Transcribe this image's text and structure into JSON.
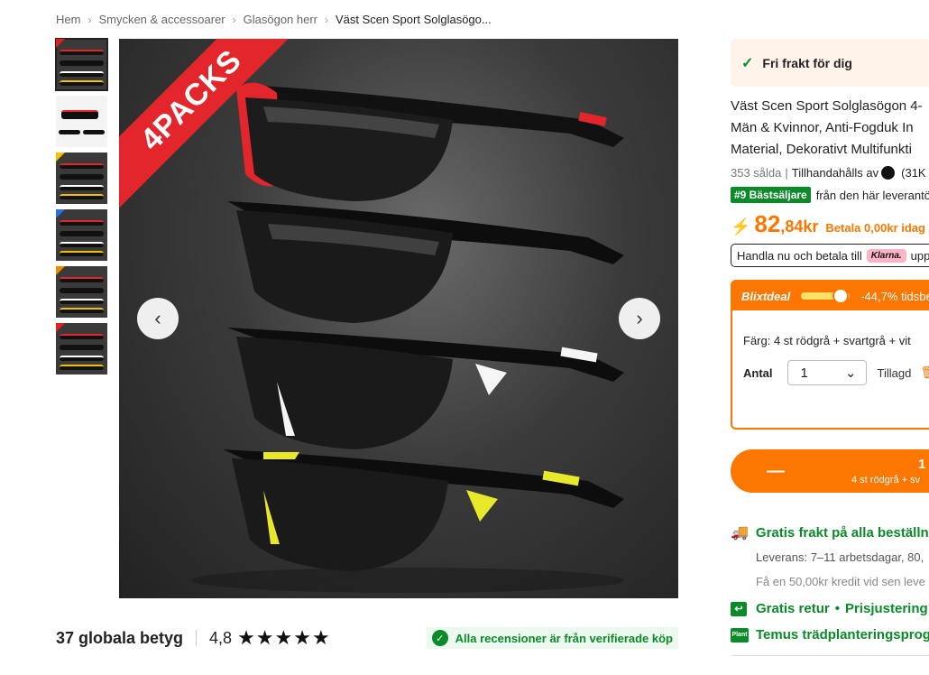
{
  "breadcrumb": [
    {
      "label": "Hem"
    },
    {
      "label": "Smycken & accessoarer"
    },
    {
      "label": "Glasögon herr"
    },
    {
      "label": "Väst Scen Sport Solglasögo..."
    }
  ],
  "gallery": {
    "banner_text": "4PACKS",
    "prev_icon": "chevron-left-icon",
    "next_icon": "chevron-right-icon",
    "accent_colors": [
      "#e3262b",
      "#e3262b",
      "#f2c200",
      "#2b6fe0",
      "#f08a00",
      "#e3262b"
    ]
  },
  "ratings": {
    "count_label": "37 globala betyg",
    "score": "4,8",
    "stars": "★★★★★",
    "verified_text": "Alla recensioner är från verifierade köp"
  },
  "product": {
    "free_shipping": "Fri frakt för dig",
    "title_line1": "Väst Scen Sport Solglasögon 4-",
    "title_line2": "Män & Kvinnor, Anti-Fogduk In",
    "title_line3": "Material, Dekorativt Multifunkti",
    "sold": "353 sålda",
    "separator": "|",
    "provided_by": "Tillhandahålls av",
    "seller_count": "(31K",
    "bestseller_badge": "#9 Bästsäljare",
    "bestseller_text": "från den här leverantö",
    "price_main": "82",
    "price_fraction": ",84kr",
    "pay_today": "Betala 0,00kr idag",
    "klarna_prefix": "Handla nu och betala till",
    "klarna_logo": "Klarna.",
    "klarna_suffix": "upp t"
  },
  "deal": {
    "title": "Blixtdeal",
    "discount_text": "-44,7% tidsbe",
    "progress": 0.82,
    "color_label": "Färg: 4 st rödgrå + svartgrå + vit",
    "quantity_label": "Antal",
    "quantity_value": "1",
    "added_text": "Tillagd"
  },
  "cart": {
    "minus": "—",
    "quantity": "1",
    "variant": "4 st rödgrå + sv"
  },
  "shipping": {
    "title": "Gratis frakt på alla beställn",
    "delivery": "Leverans: 7–11 arbetsdagar, 80,",
    "credit": "Få en 50,00kr kredit vid sen leve",
    "returns": "Gratis retur",
    "dot": "•",
    "price_adjust": "Prisjustering",
    "tree_icon_text": "Plant",
    "tree": "Temus trädplanteringsprog"
  },
  "colors": {
    "accent": "#fb7701",
    "green": "#0a8a28",
    "banner": "#e3262b"
  }
}
